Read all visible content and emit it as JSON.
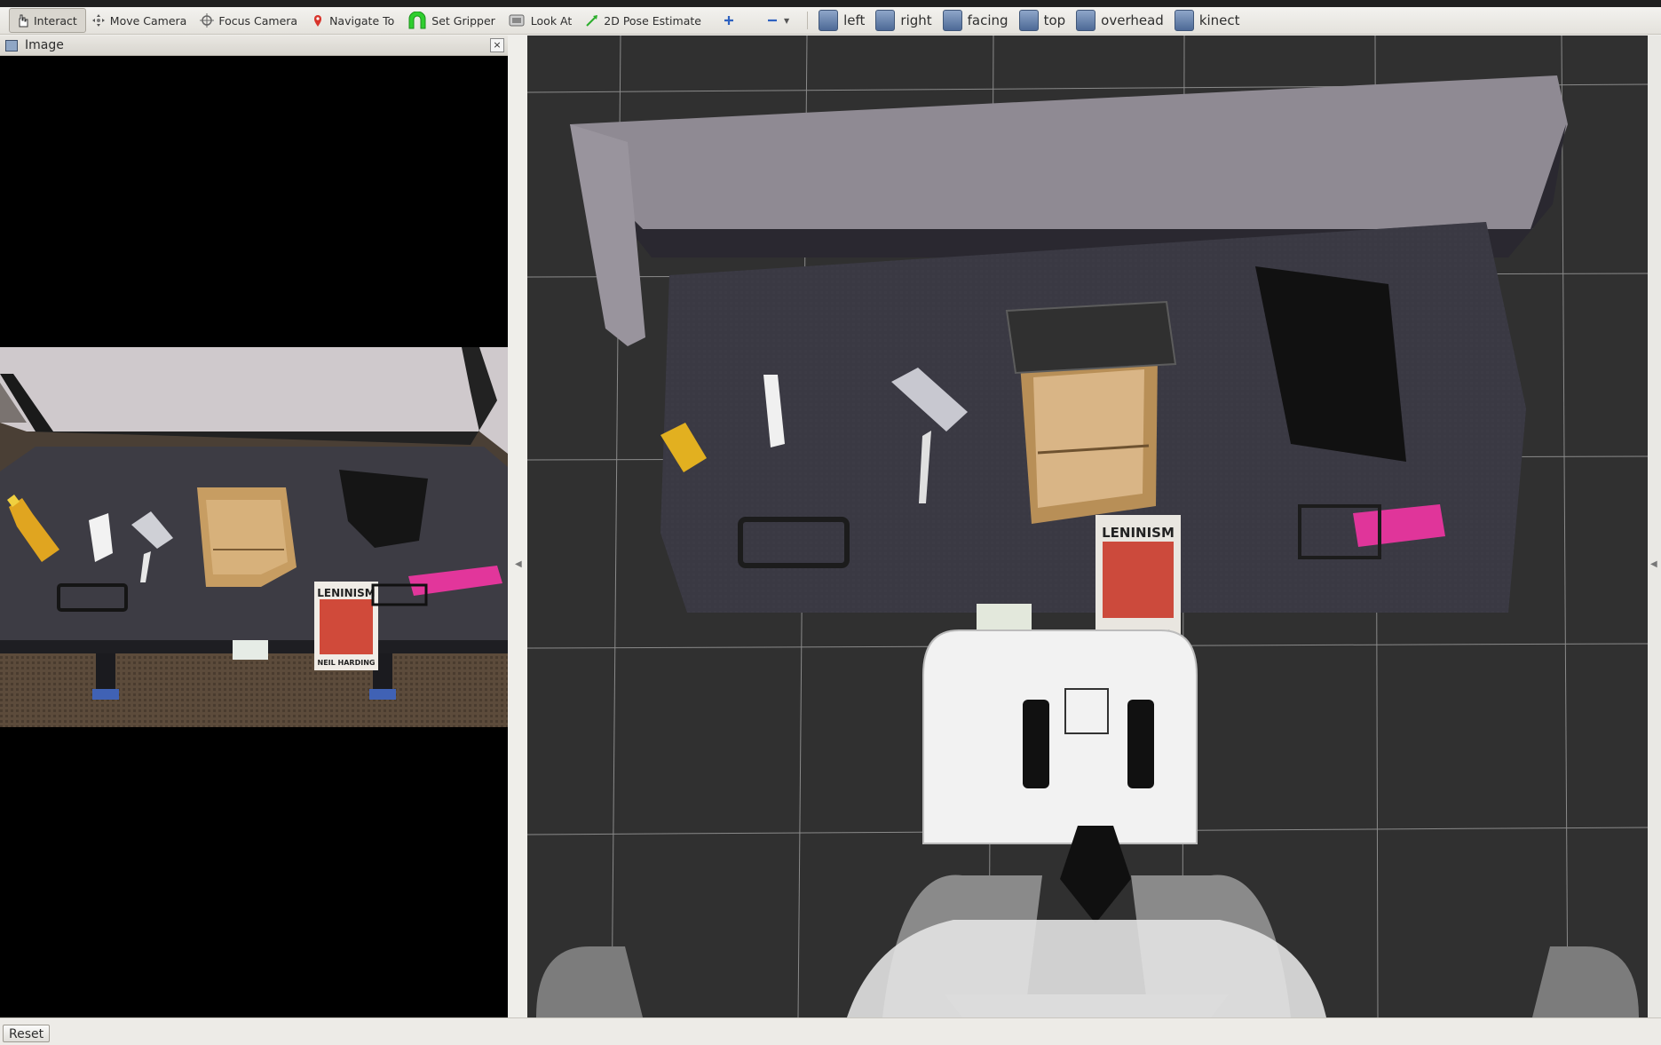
{
  "toolbar": {
    "tools": [
      {
        "label": "Interact",
        "icon": "hand-cursor-icon"
      },
      {
        "label": "Move Camera",
        "icon": "move-camera-icon"
      },
      {
        "label": "Focus Camera",
        "icon": "crosshair-icon"
      },
      {
        "label": "Navigate To",
        "icon": "map-pin-icon"
      },
      {
        "label": "Set Gripper",
        "icon": "gripper-icon"
      },
      {
        "label": "Look At",
        "icon": "look-at-icon"
      },
      {
        "label": "2D Pose Estimate",
        "icon": "pose-arrow-icon"
      }
    ],
    "add_icon": "plus-icon",
    "remove_icon": "minus-icon",
    "views": [
      {
        "label": "left",
        "icon": "left-view-icon"
      },
      {
        "label": "right",
        "icon": "right-view-icon"
      },
      {
        "label": "facing",
        "icon": "facing-view-icon"
      },
      {
        "label": "top",
        "icon": "top-view-icon"
      },
      {
        "label": "overhead",
        "icon": "overhead-view-icon"
      },
      {
        "label": "kinect",
        "icon": "kinect-view-icon"
      }
    ]
  },
  "image_panel": {
    "title": "Image",
    "close_label": "×"
  },
  "scene": {
    "poster_title": "LENINISM",
    "poster_subtitle": "NEIL HARDING"
  },
  "statusbar": {
    "reset_label": "Reset"
  },
  "colors": {
    "viewport_bg": "#303030",
    "grid_line": "#a8a8a8",
    "toolbar_bg": "#eeede9",
    "active_tool_bg": "#d9d6cf",
    "table_top": "#3b3b44",
    "cardboard": "#c29a62",
    "pink_box": "#e0359a",
    "robot_white": "#f2f2f2"
  }
}
